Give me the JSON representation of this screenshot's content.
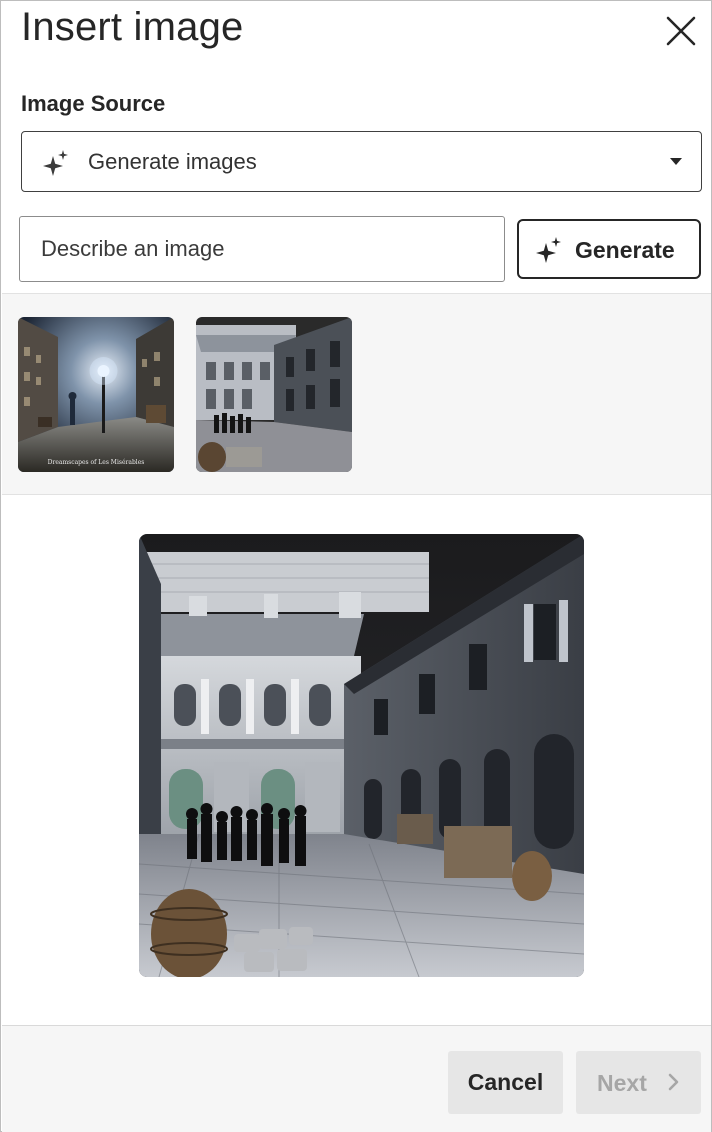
{
  "dialog": {
    "title": "Insert image",
    "close_icon": "close-icon"
  },
  "source": {
    "label": "Image Source",
    "selected": "Generate images",
    "icon": "sparkle-icon",
    "caret_icon": "caret-down-icon"
  },
  "prompt": {
    "placeholder": "Describe an image",
    "value": ""
  },
  "generate": {
    "label": "Generate",
    "icon": "sparkle-icon"
  },
  "thumbnails": [
    {
      "name": "night-street-lamp-scene",
      "caption": "Dreamscapes of Les Misérables",
      "selected": false
    },
    {
      "name": "parisian-courtyard-silhouettes",
      "selected": true
    }
  ],
  "preview": {
    "image": "parisian-courtyard-silhouettes"
  },
  "footer": {
    "cancel_label": "Cancel",
    "next_label": "Next",
    "next_icon": "chevron-right-icon",
    "next_disabled": true
  },
  "colors": {
    "text": "#262626",
    "border": "#404040",
    "panel_bg": "#f6f6f6",
    "button_bg": "#e6e6e6",
    "disabled_text": "#a6a6a6"
  }
}
